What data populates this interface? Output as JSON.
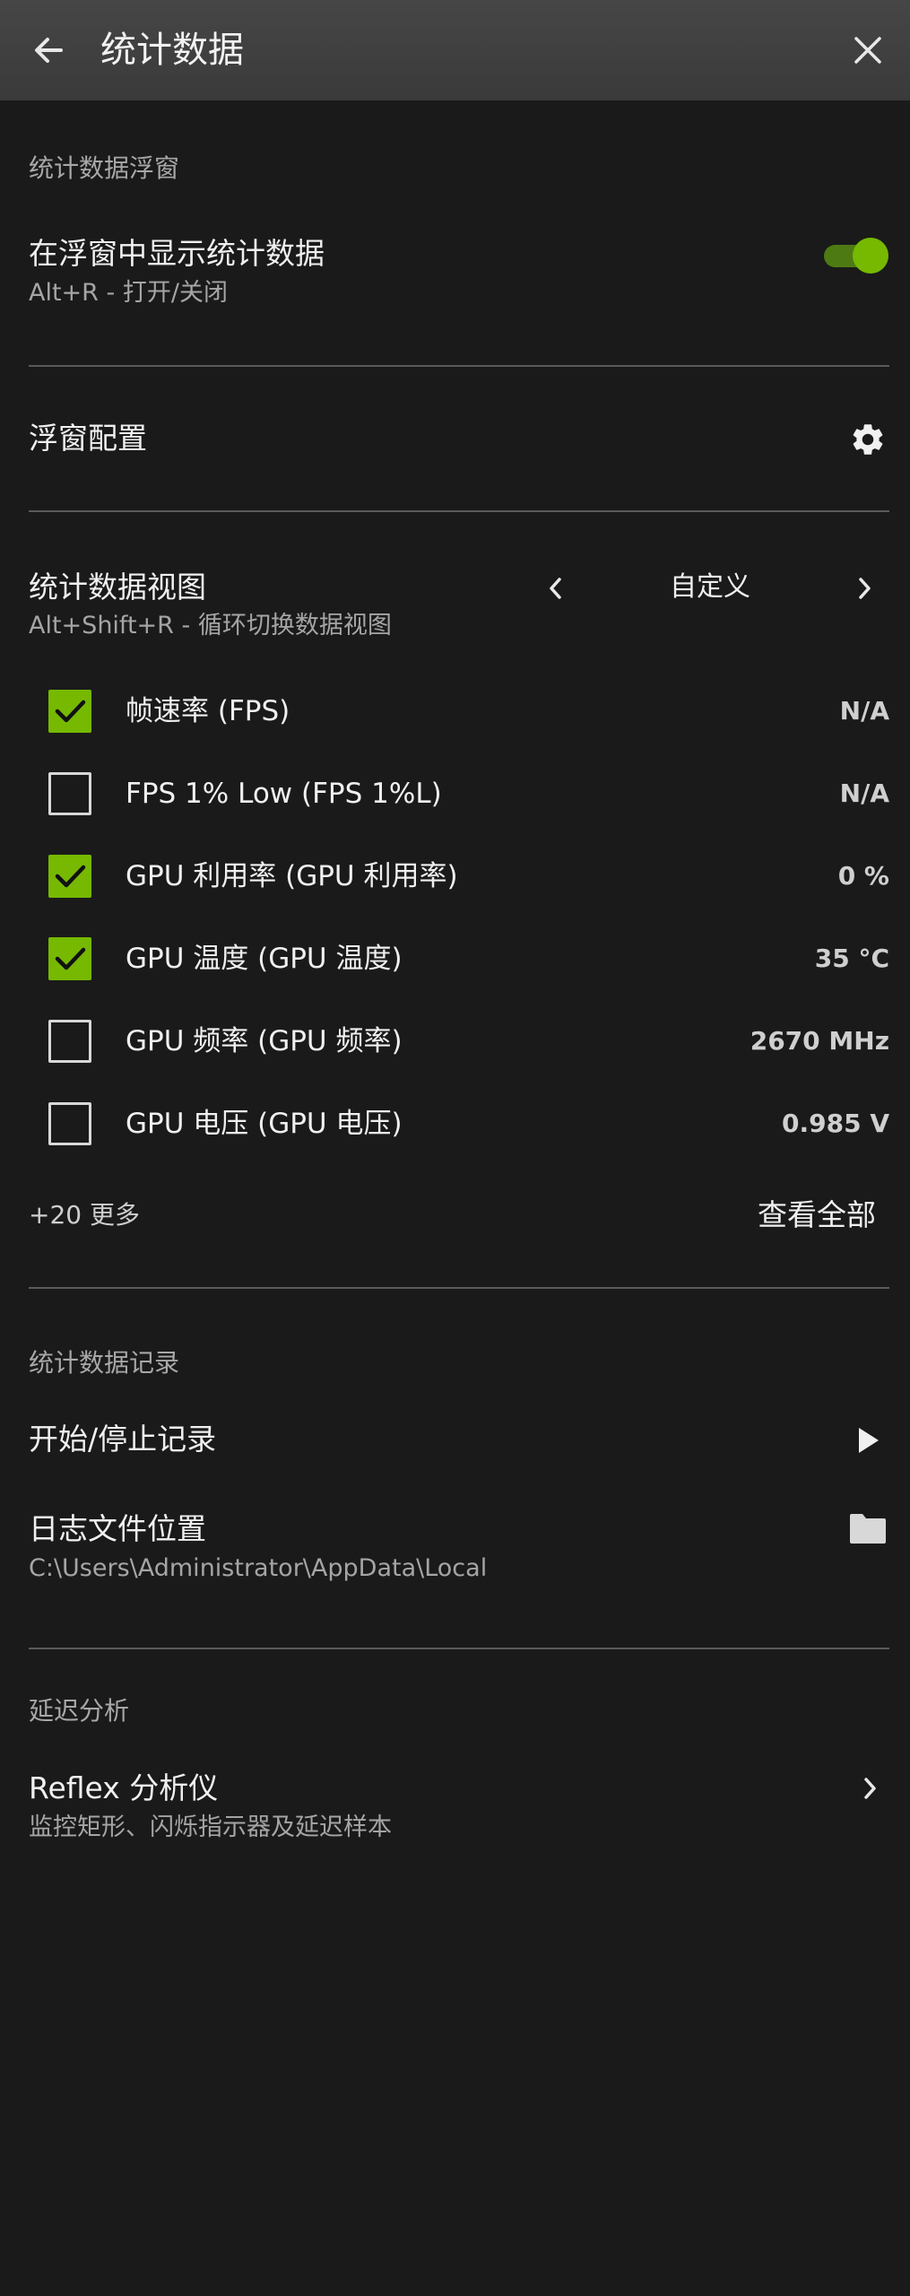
{
  "header": {
    "title": "统计数据",
    "back_icon": "arrow-left-icon",
    "close_icon": "close-icon"
  },
  "overlay_section": {
    "title": "统计数据浮窗",
    "show_overlay": {
      "label": "在浮窗中显示统计数据",
      "shortcut": "Alt+R - 打开/关闭",
      "enabled": true
    },
    "config": {
      "label": "浮窗配置",
      "icon": "gear-icon"
    }
  },
  "stats_view": {
    "label": "统计数据视图",
    "shortcut": "Alt+Shift+R - 循环切换数据视图",
    "current_view": "自定义",
    "prev_icon": "chevron-left-icon",
    "next_icon": "chevron-right-icon",
    "metrics": [
      {
        "label": "帧速率 (FPS)",
        "value": "N/A",
        "checked": true
      },
      {
        "label": "FPS 1% Low (FPS 1%L)",
        "value": "N/A",
        "checked": false
      },
      {
        "label": "GPU 利用率 (GPU 利用率)",
        "value": "0 %",
        "checked": true
      },
      {
        "label": "GPU 温度 (GPU 温度)",
        "value": "35 °C",
        "checked": true
      },
      {
        "label": "GPU 频率 (GPU 频率)",
        "value": "2670 MHz",
        "checked": false
      },
      {
        "label": "GPU 电压 (GPU 电压)",
        "value": "0.985 V",
        "checked": false
      }
    ],
    "more_count": "+20 更多",
    "view_all": "查看全部"
  },
  "logging_section": {
    "title": "统计数据记录",
    "start_stop": {
      "label": "开始/停止记录",
      "icon": "play-icon"
    },
    "log_location": {
      "label": "日志文件位置",
      "path": "C:\\Users\\Administrator\\AppData\\Local",
      "icon": "folder-icon"
    }
  },
  "latency_section": {
    "title": "延迟分析",
    "reflex": {
      "label": "Reflex 分析仪",
      "description": "监控矩形、闪烁指示器及延迟样本",
      "icon": "chevron-right-icon"
    }
  },
  "colors": {
    "background": "#1a1a1a",
    "header": "#404040",
    "accent": "#76b900",
    "divider": "#5a5a5a"
  }
}
